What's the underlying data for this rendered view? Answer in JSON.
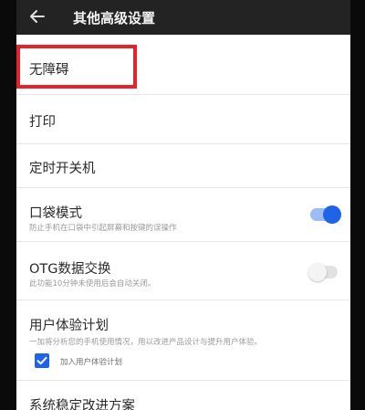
{
  "appbar": {
    "title": "其他高级设置",
    "back_icon": "arrow-left-icon"
  },
  "items": {
    "accessibility": {
      "label": "无障碍"
    },
    "print": {
      "label": "打印"
    },
    "scheduled_power": {
      "label": "定时开关机"
    },
    "pocket_mode": {
      "label": "口袋模式",
      "description": "防止手机在口袋中引起屏幕和按键的误操作",
      "enabled": true
    },
    "otg": {
      "label": "OTG数据交换",
      "description": "此功能10分钟未使用后会自动关闭。",
      "enabled": false
    },
    "user_experience": {
      "label": "用户体验计划",
      "description": "一加将分析您的手机使用情况，用以改进产品设计与提升用户体验。",
      "checkbox_label": "加入用户体验计划",
      "checked": true
    },
    "stability": {
      "label": "系统稳定改进方案"
    }
  },
  "colors": {
    "accent": "#1f63e6",
    "highlight": "#e5232b",
    "appbar": "#232323"
  }
}
